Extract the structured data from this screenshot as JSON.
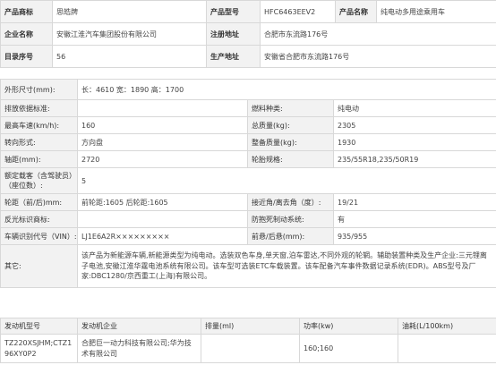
{
  "top": {
    "row1": {
      "l1": "产品商标",
      "v1": "思皓牌",
      "l2": "产品型号",
      "v2": "HFC6463EEV2",
      "l3": "产品名称",
      "v3": "纯电动多用途乘用车"
    },
    "row2": {
      "l1": "企业名称",
      "v1": "安徽江淮汽车集团股份有限公司",
      "l2": "注册地址",
      "v2": "合肥市东流路176号"
    },
    "row3": {
      "l1": "目录序号",
      "v1": "56",
      "l2": "生产地址",
      "v2": "安徽省合肥市东流路176号"
    }
  },
  "specs": {
    "dims": {
      "label": "外形尺寸(mm):",
      "value": "长：4610 宽：1890 高：1700"
    },
    "emission": {
      "label": "排放依据标准:",
      "value": "",
      "label2": "燃料种类:",
      "value2": "纯电动"
    },
    "speed": {
      "label": "最高车速(km/h):",
      "value": "160",
      "label2": "总质量(kg):",
      "value2": "2305"
    },
    "steering": {
      "label": "转向形式:",
      "value": "方向盘",
      "label2": "整备质量(kg):",
      "value2": "1930"
    },
    "wheelbase": {
      "label": "轴距(mm):",
      "value": "2720",
      "label2": "轮胎规格:",
      "value2": "235/55R18,235/50R19"
    },
    "seats": {
      "label": "额定载客（含驾驶员）（座位数）:",
      "value": "5"
    },
    "track": {
      "label": "轮距（前/后)mm:",
      "value": "前轮距:1605 后轮距:1605",
      "label2": "接近角/离去角（度）:",
      "value2": "19/21"
    },
    "reflective": {
      "label": "反光标识商标:",
      "value": "",
      "label2": "防抱死制动系统:",
      "value2": "有"
    },
    "vin": {
      "label": "车辆识别代号（VIN）:",
      "value": "LJ1E6A2R×××××××××",
      "label2": "前悬/后悬(mm):",
      "value2": "935/955"
    },
    "other": {
      "label": "其它:",
      "value": "该产品为新能源车辆,新能源类型为纯电动。选装双色车身,单天窗,泊车雷达,不同外观的轮辋。辅助装置种类及生产企业:三元锂离子电池,安徽江淮华霆电池系统有限公司。该车型可选装ETC车载装置。该车配备汽车事件数据记录系统(EDR)。ABS型号及厂家:DBC1280/京西重工(上海)有限公司。"
    }
  },
  "motor": {
    "headers": [
      "发动机型号",
      "发动机企业",
      "排量(ml)",
      "功率(kw)",
      "油耗(L/100km)"
    ],
    "row": [
      "TZ220XSJHM;CTZ196XY0P2",
      "合肥巨一动力科技有限公司;华为技术有限公司",
      "",
      "160;160",
      ""
    ]
  }
}
